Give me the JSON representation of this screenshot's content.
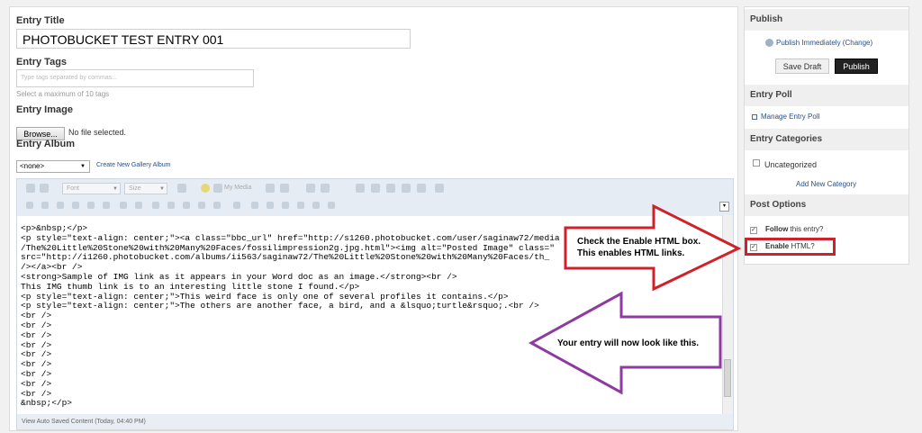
{
  "entry": {
    "title_label": "Entry Title",
    "title_value": "PHOTOBUCKET TEST ENTRY 001",
    "tags_label": "Entry Tags",
    "tags_placeholder": "Type tags separated by commas...",
    "tags_hint": "Select a maximum of 10 tags",
    "image_label": "Entry Image",
    "browse_label": "Browse...",
    "no_file": "No file selected.",
    "album_label": "Entry Album",
    "album_value": "<none>",
    "create_album_link": "Create New Gallery Album"
  },
  "editor": {
    "font_label": "Font",
    "size_label": "Size",
    "my_media": "My Media",
    "code_lines": [
      "<p>&nbsp;</p>",
      "<p style=\"text-align: center;\"><a class=\"bbc_url\" href=\"http://s1260.photobucket.com/user/saginaw72/media",
      "/The%20Little%20Stone%20with%20Many%20Faces/fossilimpression2g.jpg.html\"><img alt=\"Posted Image\" class=\"",
      "src=\"http://i1260.photobucket.com/albums/ii563/saginaw72/The%20Little%20Stone%20with%20Many%20Faces/th_",
      "/></a><br />",
      "<strong>Sample of IMG link as it appears in your Word doc as an image.</strong><br />",
      "This IMG thumb link is to an interesting little stone I found.</p>",
      "<p style=\"text-align: center;\">This weird face is only one of several profiles it contains.</p>",
      "<p style=\"text-align: center;\">The others are another face, a bird, and a &lsquo;turtle&rsquo;.<br />",
      "<br />",
      "<br />",
      "<br />",
      "<br />",
      "<br />",
      "<br />",
      "<br />",
      "<br />",
      "<br />",
      "&nbsp;</p>"
    ],
    "status": "View Auto Saved Content (Today, 04:40 PM)"
  },
  "sidebar": {
    "publish_header": "Publish",
    "publish_link": "Publish Immediately (Change)",
    "save_draft": "Save Draft",
    "publish_button": "Publish",
    "poll_header": "Entry Poll",
    "manage_poll": "Manage Entry Poll",
    "categories_header": "Entry Categories",
    "uncategorized": "Uncategorized",
    "add_category": "Add New Category",
    "post_options_header": "Post Options",
    "follow_bold": "Follow",
    "follow_rest": " this entry?",
    "enable_bold": "Enable",
    "enable_rest": " HTML?"
  },
  "annotations": {
    "red_line1": "Check the Enable HTML box.",
    "red_line2": "This enables HTML links.",
    "purple_text": "Your entry will now look like this."
  },
  "colors": {
    "red_arrow": "#d0202a",
    "purple_arrow": "#8e3aa0"
  }
}
